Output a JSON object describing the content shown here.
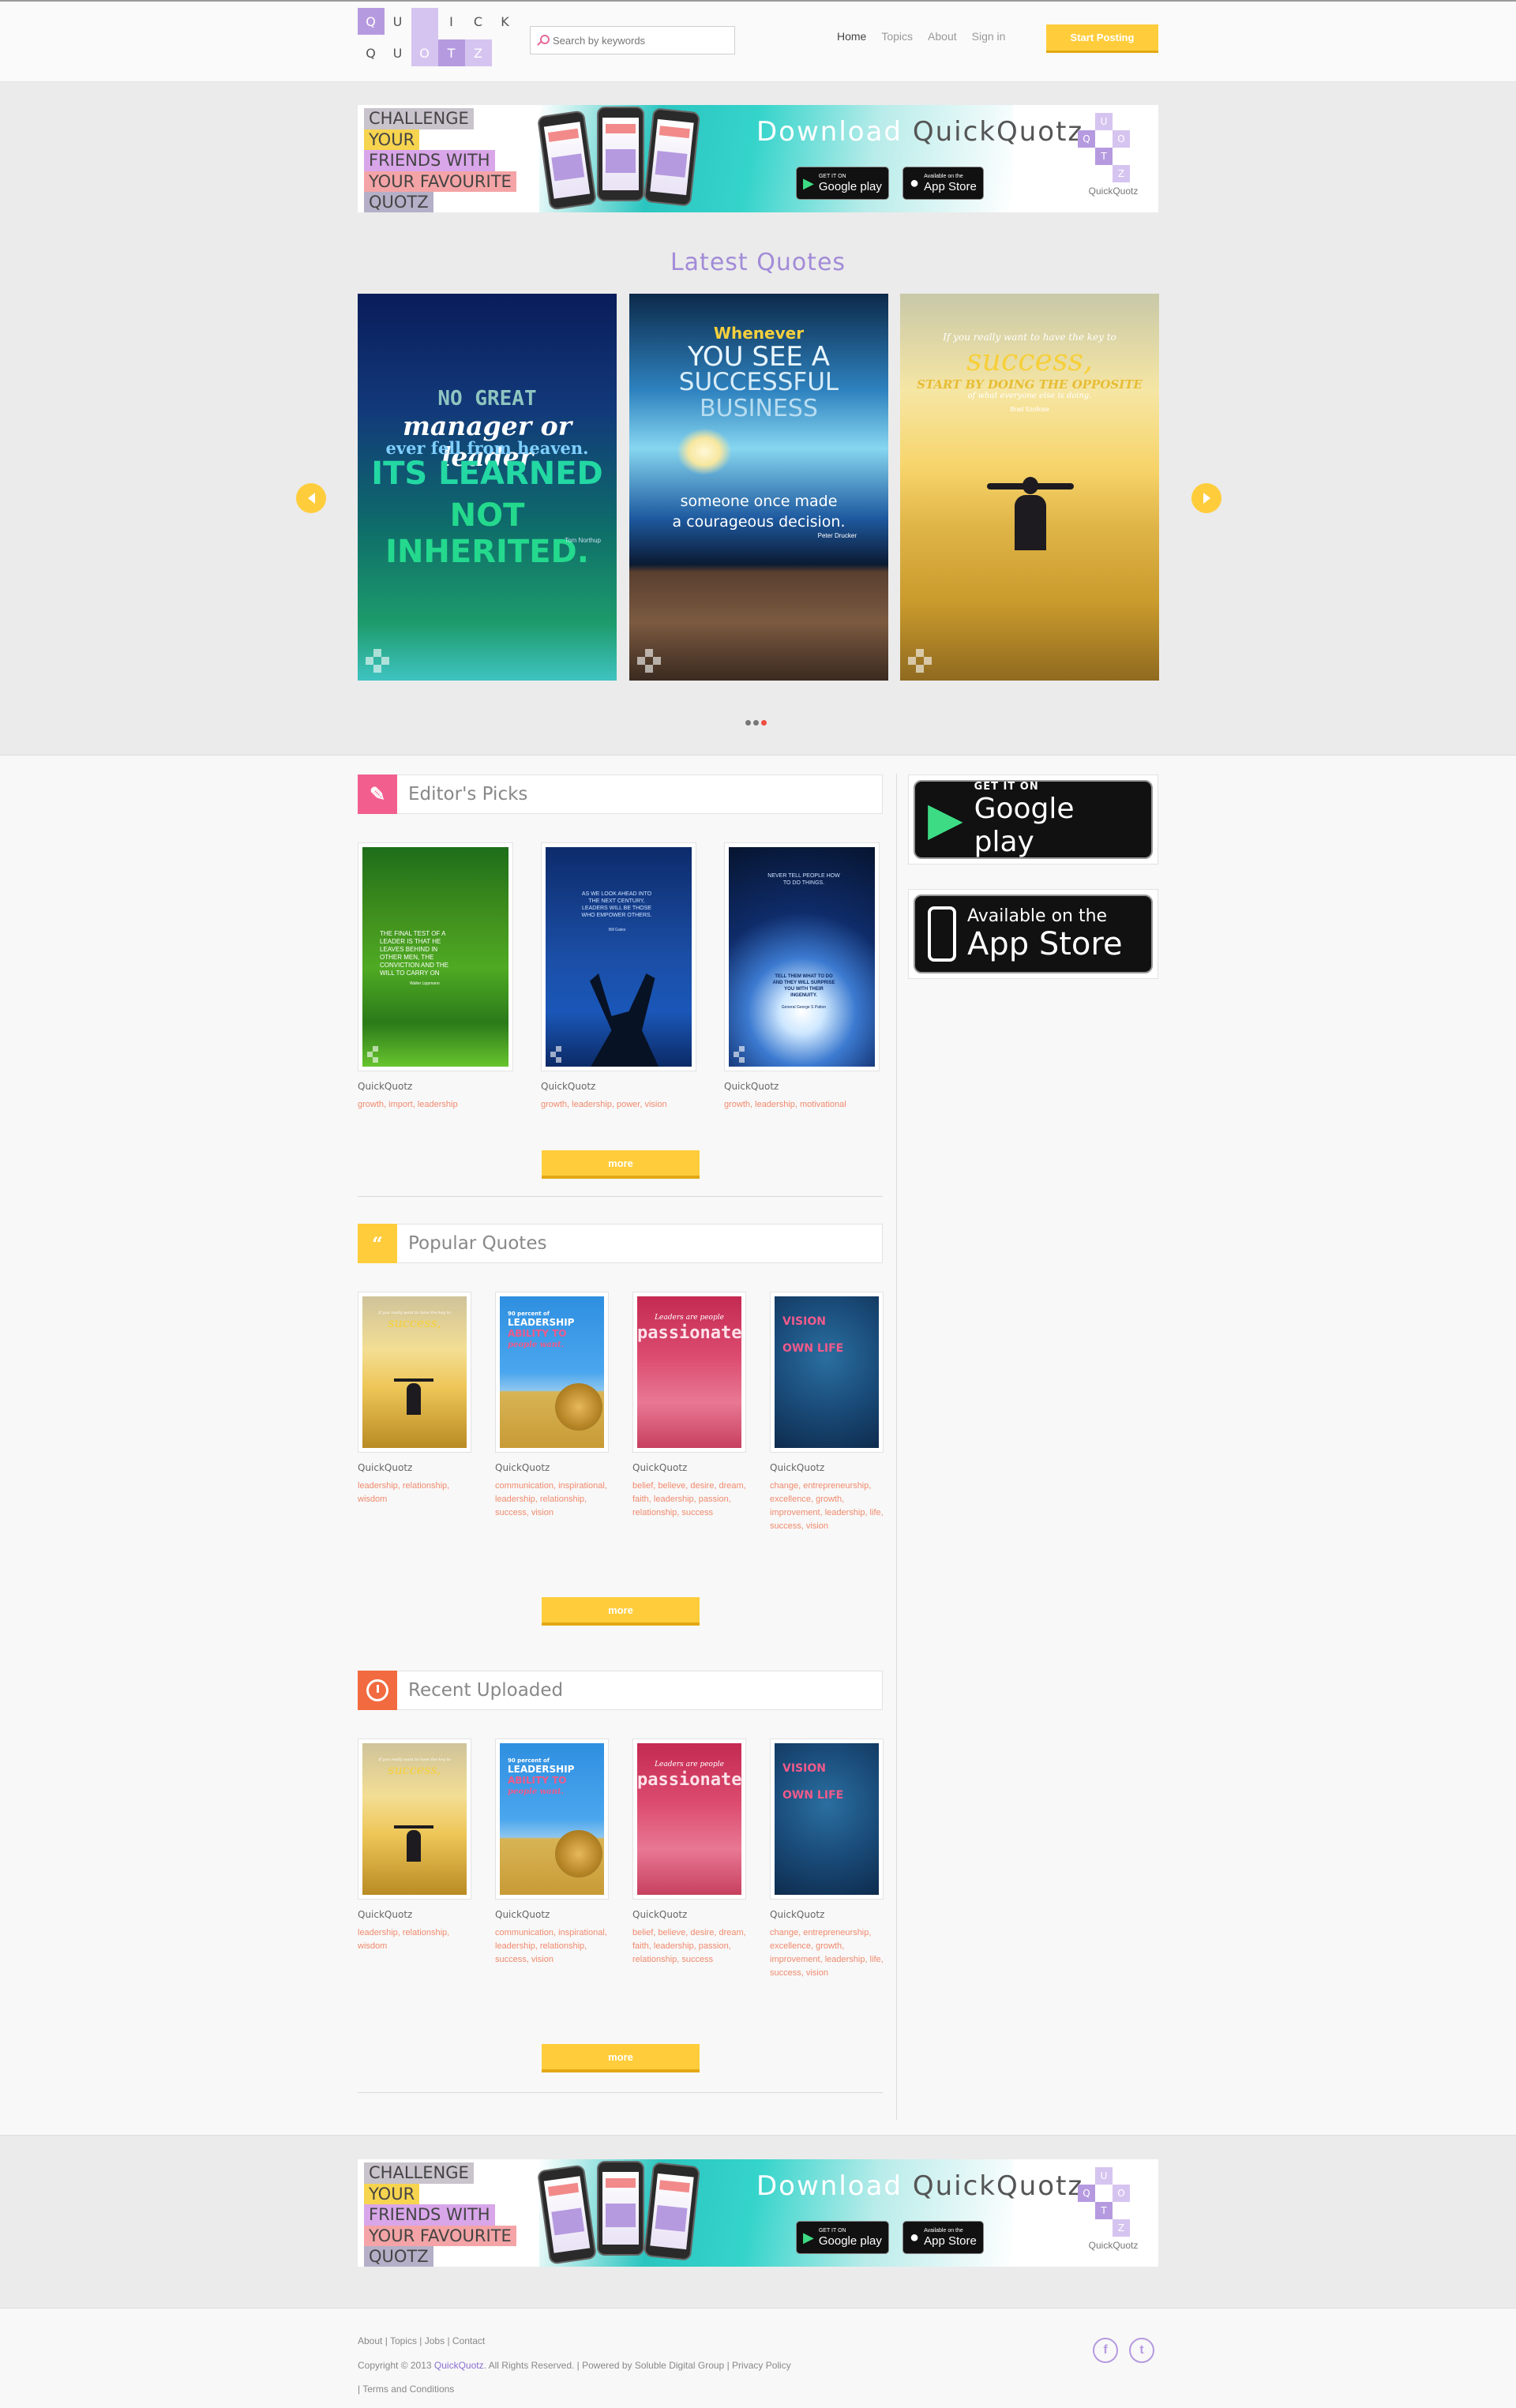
{
  "logo": {
    "letters": [
      "Q",
      "U",
      "I",
      "C",
      "K",
      "Q",
      "U",
      "O",
      "T",
      "Z"
    ]
  },
  "search": {
    "placeholder": "Search by keywords"
  },
  "nav": {
    "items": [
      "Home",
      "Topics",
      "About",
      "Sign in"
    ],
    "cta": "Start Posting"
  },
  "banner": {
    "lines": [
      "CHALLENGE",
      "YOUR",
      "FRIENDS WITH",
      "YOUR FAVOURITE",
      "QUOTZ"
    ],
    "download": "Download",
    "app_name": "QuickQuotz",
    "google_small": "GET IT ON",
    "google_big": "Google play",
    "apple_small": "Available on the",
    "apple_big": "App Store",
    "logo_label": "QuickQuotz"
  },
  "latest": {
    "title": "Latest Quotes",
    "slides": [
      {
        "lines": [
          "NO GREAT",
          "manager or leader",
          "ever fell from heaven.",
          "ITS LEARNED",
          "NOT INHERITED."
        ],
        "author": "Tom Northup"
      },
      {
        "lines": [
          "Whenever",
          "YOU SEE A",
          "SUCCESSFUL",
          "BUSINESS",
          "someone once made",
          "a courageous decision."
        ],
        "author": "Peter Drucker"
      },
      {
        "lines": [
          "If you really want to have the key to",
          "success,",
          "START BY DOING THE OPPOSITE",
          "of what everyone else is doing."
        ],
        "author": "Brad Szollose"
      }
    ]
  },
  "editors": {
    "title": "Editor's Picks",
    "more": "more",
    "cards": [
      {
        "brand": "QuickQuotz",
        "tags": "growth, import, leadership",
        "quote": "THE FINAL TEST OF A LEADER IS THAT HE LEAVES BEHIND IN OTHER MEN, THE CONVICTION AND THE WILL TO CARRY ON",
        "author": "Walter Lippmann"
      },
      {
        "brand": "QuickQuotz",
        "tags": "growth, leadership, power, vision",
        "quote": "AS WE LOOK AHEAD INTO THE NEXT CENTURY, LEADERS WILL BE THOSE WHO EMPOWER OTHERS.",
        "author": "Bill Gates"
      },
      {
        "brand": "QuickQuotz",
        "tags": "growth, leadership, motivational",
        "quote": "NEVER TELL PEOPLE HOW TO DO THINGS.",
        "quote2": "TELL THEM WHAT TO DO AND THEY WILL SURPRISE YOU WITH THEIR INGENUITY.",
        "author": "General George S Patton"
      }
    ]
  },
  "popular": {
    "title": "Popular Quotes",
    "more": "more",
    "cards": [
      {
        "brand": "QuickQuotz",
        "tags": "leadership, relationship, wisdom"
      },
      {
        "brand": "QuickQuotz",
        "tags": "communication, inspirational, leadership, relationship, success, vision"
      },
      {
        "brand": "QuickQuotz",
        "tags": "belief, believe, desire, dream, faith, leadership, passion, relationship, success"
      },
      {
        "brand": "QuickQuotz",
        "tags": "change, entrepreneurship, excellence, growth, improvement, leadership, life, success, vision"
      }
    ]
  },
  "recent": {
    "title": "Recent Uploaded",
    "more": "more",
    "cards": [
      {
        "brand": "QuickQuotz",
        "tags": "leadership, relationship, wisdom"
      },
      {
        "brand": "QuickQuotz",
        "tags": "communication, inspirational, leadership, relationship, success, vision"
      },
      {
        "brand": "QuickQuotz",
        "tags": "belief, believe, desire, dream, faith, leadership, passion, relationship, success"
      },
      {
        "brand": "QuickQuotz",
        "tags": "change, entrepreneurship, excellence, growth, improvement, leadership, life, success, vision"
      }
    ]
  },
  "thumbs": {
    "success": [
      "If you really want to have the key to",
      "success,"
    ],
    "leadership": [
      "90 percent of",
      "LEADERSHIP",
      "ABILITY TO",
      "people want."
    ],
    "passion": [
      "Leaders are people",
      "passionately"
    ],
    "vision": [
      "VISION",
      "OWN LIFE"
    ]
  },
  "sidebar": {
    "google_small": "GET IT ON",
    "google_big": "Google play",
    "apple_small": "Available on the",
    "apple_big": "App Store"
  },
  "footer": {
    "links": [
      "About",
      "Topics",
      "Jobs",
      "Contact"
    ],
    "copyright": "Copyright © 2013",
    "brand": "QuickQuotz",
    "rights": ". All Rights Reserved.",
    "powered": "Powered by Soluble Digital Group",
    "privacy": "Privacy Policy",
    "terms": "Terms and Conditions",
    "social": [
      "f",
      "t"
    ]
  },
  "colors": {
    "accent": "#ffcd3c",
    "purple": "#a28bd8",
    "tag": "#f08a6d"
  }
}
